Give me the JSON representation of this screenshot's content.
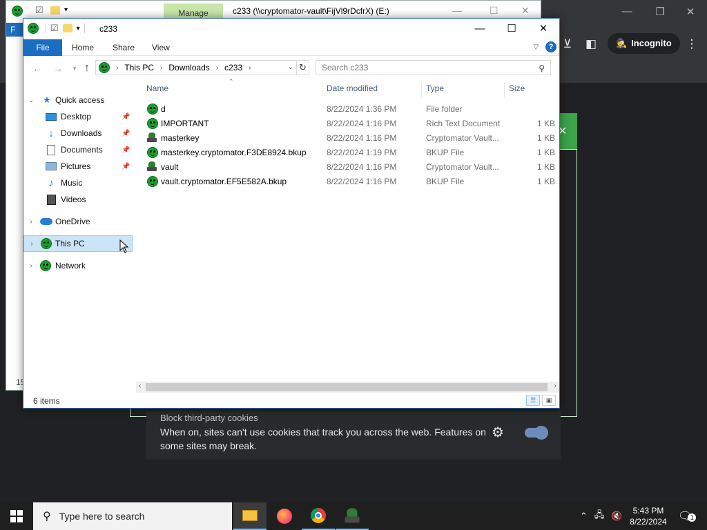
{
  "back_window": {
    "manage_tab": "Manage",
    "title": "c233 (\\\\cryptomator-vault\\FijVl9rDcfrX) (E:)",
    "ribbon_file_fragment": "F",
    "side_text": "15"
  },
  "browser": {
    "incognito_label": "Incognito",
    "cookie_title": "Block third-party cookies",
    "cookie_desc": "When on, sites can't use cookies that track you across the web. Features on some sites may break."
  },
  "window": {
    "title": "c233",
    "ribbon_tabs": [
      "File",
      "Home",
      "Share",
      "View"
    ],
    "address": [
      "This PC",
      "Downloads",
      "c233"
    ],
    "search_placeholder": "Search c233"
  },
  "nav": {
    "quick_access": "Quick access",
    "items": [
      "Desktop",
      "Downloads",
      "Documents",
      "Pictures",
      "Music",
      "Videos"
    ],
    "onedrive": "OneDrive",
    "this_pc": "This PC",
    "network": "Network"
  },
  "columns": {
    "name": "Name",
    "date": "Date modified",
    "type": "Type",
    "size": "Size"
  },
  "files": [
    {
      "name": "d",
      "date": "8/22/2024 1:36 PM",
      "type": "File folder",
      "size": "",
      "icon": "smiley-icon"
    },
    {
      "name": "IMPORTANT",
      "date": "8/22/2024 1:16 PM",
      "type": "Rich Text Document",
      "size": "1 KB",
      "icon": "smiley-icon"
    },
    {
      "name": "masterkey",
      "date": "8/22/2024 1:16 PM",
      "type": "Cryptomator Vault...",
      "size": "1 KB",
      "icon": "cryptomator-icon"
    },
    {
      "name": "masterkey.cryptomator.F3DE8924.bkup",
      "date": "8/22/2024 1:19 PM",
      "type": "BKUP File",
      "size": "1 KB",
      "icon": "smiley-icon"
    },
    {
      "name": "vault",
      "date": "8/22/2024 1:16 PM",
      "type": "Cryptomator Vault...",
      "size": "1 KB",
      "icon": "cryptomator-icon"
    },
    {
      "name": "vault.cryptomator.EF5E582A.bkup",
      "date": "8/22/2024 1:16 PM",
      "type": "BKUP File",
      "size": "1 KB",
      "icon": "smiley-icon"
    }
  ],
  "status": {
    "count": "6 items"
  },
  "taskbar": {
    "search_placeholder": "Type here to search",
    "time": "5:43 PM",
    "date": "8/22/2024",
    "notification_count": "1"
  }
}
